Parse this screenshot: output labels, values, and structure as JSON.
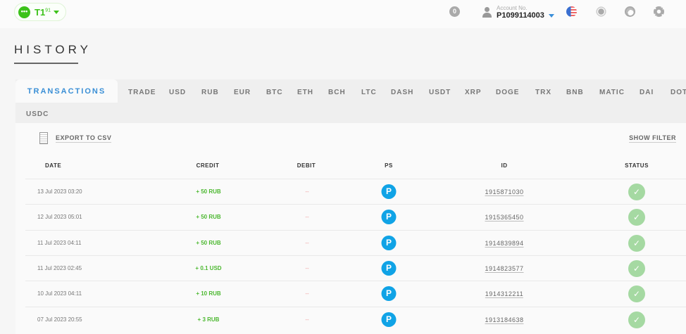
{
  "header": {
    "balance_badge": "T1",
    "balance_sup": "91",
    "notifications": "0",
    "account_label": "Account No.",
    "account_number": "P1099114003"
  },
  "page_title": "HISTORY",
  "tabs": [
    "TRANSACTIONS",
    "TRADE",
    "USD",
    "RUB",
    "EUR",
    "BTC",
    "ETH",
    "BCH",
    "LTC",
    "DASH",
    "USDT",
    "XRP",
    "DOGE",
    "TRX",
    "BNB",
    "MATIC",
    "DAI",
    "DOT",
    "USDC"
  ],
  "export_label": "EXPORT TO CSV",
  "show_filter_label": "SHOW FILTER",
  "columns": [
    "DATE",
    "CREDIT",
    "DEBIT",
    "PS",
    "ID",
    "STATUS"
  ],
  "rows": [
    {
      "date": "13 Jul 2023 03:20",
      "credit": "+ 50 RUB",
      "debit": "--",
      "ps": "P",
      "id": "1915871030",
      "status": "✓"
    },
    {
      "date": "12 Jul 2023 05:01",
      "credit": "+ 50 RUB",
      "debit": "--",
      "ps": "P",
      "id": "1915365450",
      "status": "✓"
    },
    {
      "date": "11 Jul 2023 04:11",
      "credit": "+ 50 RUB",
      "debit": "--",
      "ps": "P",
      "id": "1914839894",
      "status": "✓"
    },
    {
      "date": "11 Jul 2023 02:45",
      "credit": "+ 0.1 USD",
      "debit": "--",
      "ps": "P",
      "id": "1914823577",
      "status": "✓"
    },
    {
      "date": "10 Jul 2023 04:11",
      "credit": "+ 10 RUB",
      "debit": "--",
      "ps": "P",
      "id": "1914312211",
      "status": "✓"
    },
    {
      "date": "07 Jul 2023 20:55",
      "credit": "+ 3 RUB",
      "debit": "--",
      "ps": "P",
      "id": "1913184638",
      "status": "✓"
    }
  ]
}
